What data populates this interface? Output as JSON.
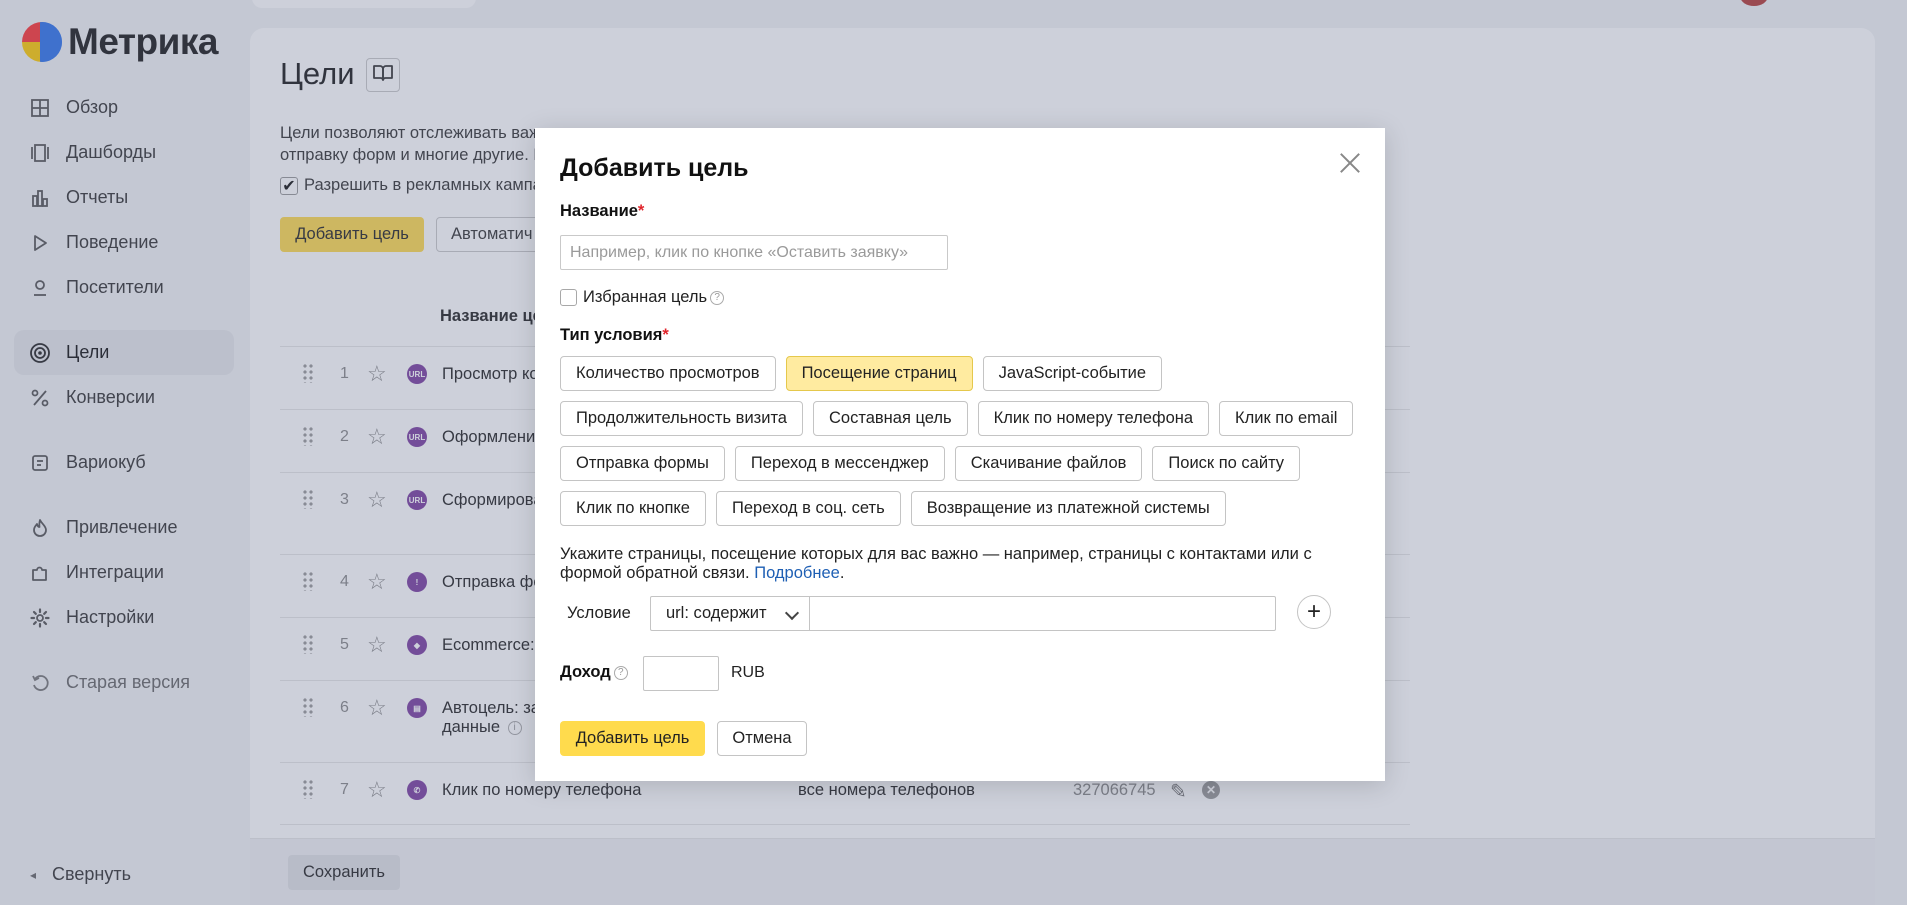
{
  "brand": {
    "name": "Метрика"
  },
  "sidebar": {
    "items": [
      {
        "label": "Обзор",
        "icon": "grid-icon"
      },
      {
        "label": "Дашборды",
        "icon": "dashboards-icon"
      },
      {
        "label": "Отчеты",
        "icon": "bar-chart-icon"
      },
      {
        "label": "Поведение",
        "icon": "play-icon"
      },
      {
        "label": "Посетители",
        "icon": "person-icon"
      },
      {
        "label": "Цели",
        "icon": "target-icon",
        "active": true
      },
      {
        "label": "Конверсии",
        "icon": "percent-icon"
      },
      {
        "label": "Вариокуб",
        "icon": "variocube-icon"
      },
      {
        "label": "Привлечение",
        "icon": "flame-icon"
      },
      {
        "label": "Интеграции",
        "icon": "puzzle-icon"
      },
      {
        "label": "Настройки",
        "icon": "gear-icon"
      },
      {
        "label": "Старая версия",
        "icon": "undo-icon"
      }
    ],
    "collapse_label": "Свернуть"
  },
  "page": {
    "title": "Цели",
    "intro_line1": "Цели позволяют отслеживать важ",
    "intro_line2": "отправку форм и многие другие. Н",
    "allow_label": "Разрешить в рекламных кампа",
    "add_goal_label": "Добавить цель",
    "auto_label": "Автоматич",
    "col_name": "Название це",
    "save_label": "Сохранить"
  },
  "goals": [
    {
      "num": "1",
      "badge": "URL",
      "name": "Просмотр ко",
      "condition": "",
      "id": ""
    },
    {
      "num": "2",
      "badge": "URL",
      "name": "Оформление",
      "condition": "",
      "id": ""
    },
    {
      "num": "3",
      "badge": "URL",
      "name": "Сформирова",
      "condition": "",
      "id": ""
    },
    {
      "num": "4",
      "badge": "!",
      "name": "Отправка фо",
      "condition": "",
      "id": ""
    },
    {
      "num": "5",
      "badge": "◆",
      "name": "Ecommerce: д",
      "condition": "",
      "id": ""
    },
    {
      "num": "6",
      "badge": "▤",
      "name": "Автоцель: за",
      "name2": "данные",
      "condition": "",
      "id": ""
    },
    {
      "num": "7",
      "badge": "✆",
      "name": "Клик по номеру телефона",
      "condition": "все номера телефонов",
      "id": "327066745"
    }
  ],
  "modal": {
    "title": "Добавить цель",
    "name_label": "Название",
    "required_mark": "*",
    "name_placeholder": "Например, клик по кнопке «Оставить заявку»",
    "favorite_label": "Избранная цель",
    "help_mark": "?",
    "type_label": "Тип условия",
    "condition_types": [
      [
        "Количество просмотров",
        "Посещение страниц",
        "JavaScript-событие"
      ],
      [
        "Продолжительность визита",
        "Составная цель",
        "Клик по номеру телефона",
        "Клик по email"
      ],
      [
        "Отправка формы",
        "Переход в мессенджер",
        "Скачивание файлов",
        "Поиск по сайту"
      ],
      [
        "Клик по кнопке",
        "Переход в соц. сеть",
        "Возвращение из платежной системы"
      ]
    ],
    "selected_type": "Посещение страниц",
    "hint_text": "Укажите страницы, посещение которых для вас важно — например, страницы с контактами или с формой обратной связи.",
    "hint_link": "Подробнее",
    "hint_period": ".",
    "condition_label": "Условие",
    "condition_select": "url: содержит",
    "condition_value": "",
    "plus_symbol": "+",
    "income_label": "Доход",
    "income_value": "",
    "currency": "RUB",
    "submit_label": "Добавить цель",
    "cancel_label": "Отмена"
  },
  "colors": {
    "accent": "#ffdb4d",
    "selected_chip": "#ffeba0",
    "link": "#1e5fb4",
    "goal_badge": "#7b3fa0"
  }
}
